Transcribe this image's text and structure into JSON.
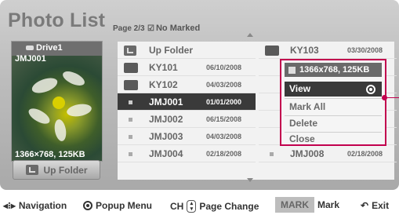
{
  "header": {
    "title": "Photo List",
    "page": "Page 2/3",
    "mark_status": "No Marked",
    "mark_check": "☑"
  },
  "preview": {
    "drive": "Drive1",
    "file": "JMJ001",
    "resolution": "1366×768, 125KB",
    "up_folder_button": "Up Folder"
  },
  "list": {
    "left": [
      {
        "type": "up-folder",
        "name": "Up Folder",
        "date": ""
      },
      {
        "type": "folder",
        "name": "KY101",
        "date": "06/10/2008"
      },
      {
        "type": "folder",
        "name": "KY102",
        "date": "04/03/2008"
      },
      {
        "type": "photo",
        "name": "JMJ001",
        "date": "01/01/2000",
        "selected": true
      },
      {
        "type": "photo",
        "name": "JMJ002",
        "date": "06/15/2008"
      },
      {
        "type": "photo",
        "name": "JMJ003",
        "date": "04/03/2008"
      },
      {
        "type": "photo",
        "name": "JMJ004",
        "date": "02/18/2008"
      }
    ],
    "right": [
      {
        "type": "folder",
        "name": "KY103",
        "date": "03/30/2008"
      },
      {
        "type": "photo",
        "name": "JMJ008",
        "date": "02/18/2008"
      }
    ]
  },
  "popup": {
    "header": "1366x768, 125KB",
    "items": [
      "View",
      "Mark All",
      "Delete",
      "Close"
    ],
    "selected": "View"
  },
  "footer": {
    "navigation": "Navigation",
    "popup_menu": "Popup Menu",
    "ch": "CH",
    "page_change": "Page Change",
    "mark_button": "MARK",
    "mark": "Mark",
    "exit": "Exit"
  },
  "colors": {
    "accent": "#c2004e",
    "selected_row": "#3a3a3a"
  }
}
